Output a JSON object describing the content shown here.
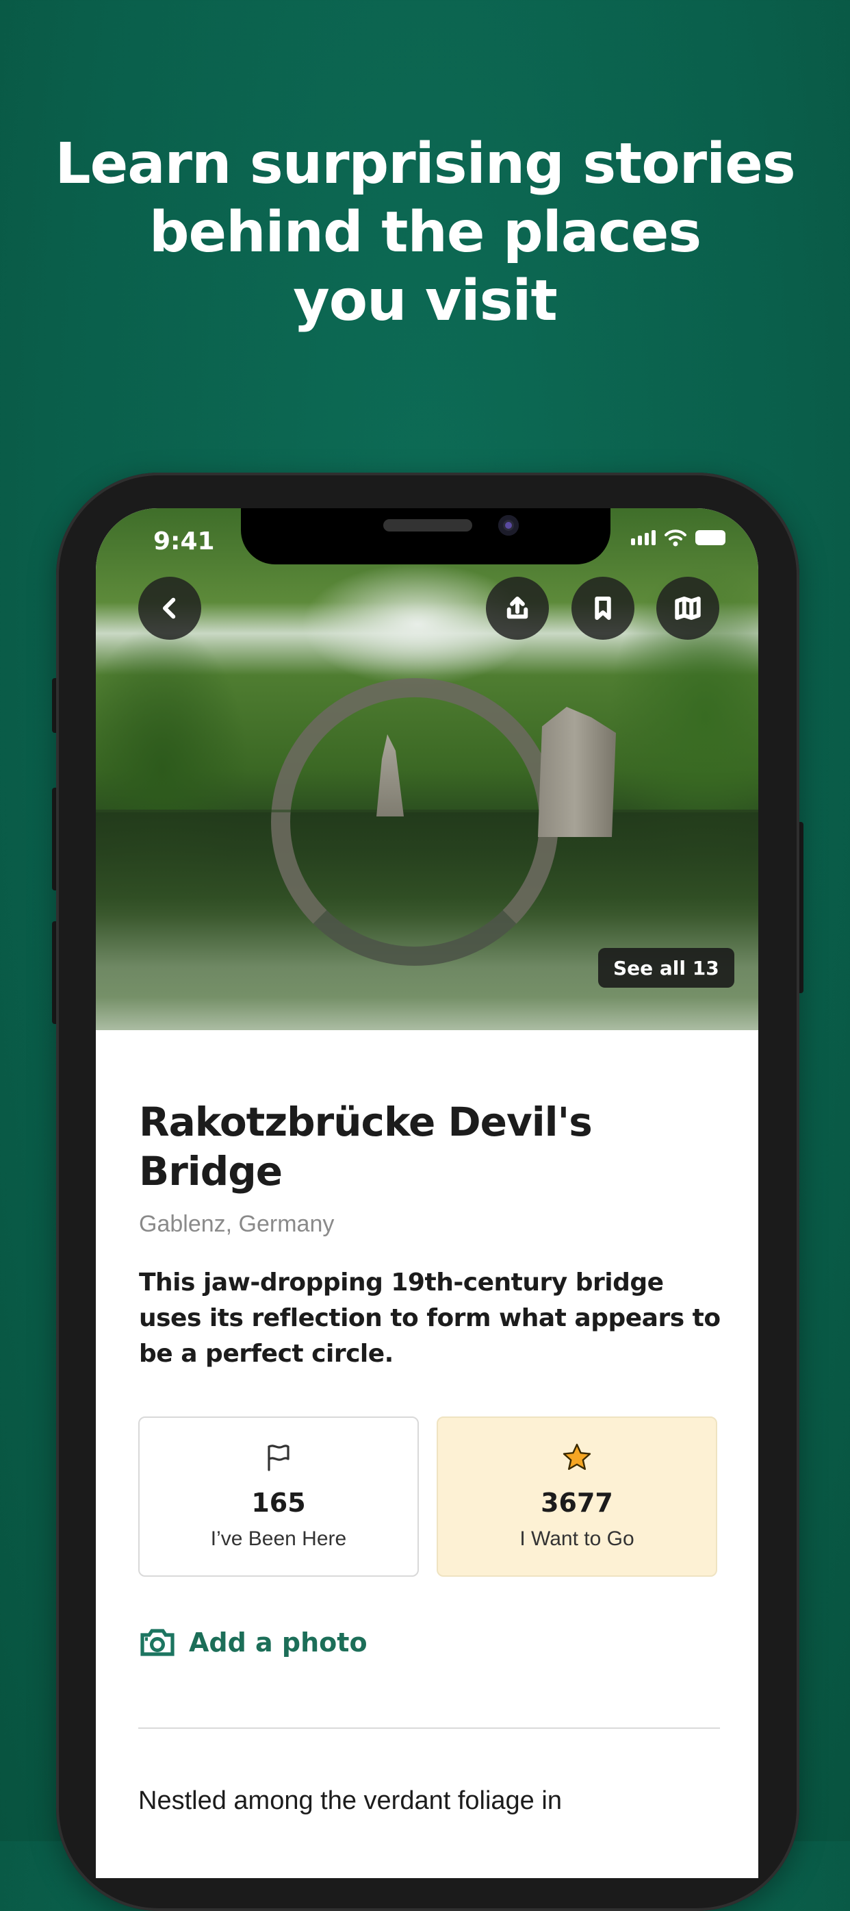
{
  "headline": {
    "line1": "Learn surprising stories",
    "line2": "behind the places",
    "line3": "you visit"
  },
  "status_bar": {
    "time": "9:41"
  },
  "hero": {
    "see_all_label": "See all 13",
    "buttons": [
      "back-icon",
      "share-icon",
      "bookmark-icon",
      "map-icon"
    ]
  },
  "place": {
    "title": "Rakotzbrücke Devil's Bridge",
    "location": "Gablenz, Germany",
    "summary": "This jaw-dropping 19th-century bridge uses its reflection to form what appears to be a perfect circle."
  },
  "stats": {
    "been_here": {
      "count": "165",
      "label": "I’ve Been Here",
      "icon": "flag-icon"
    },
    "want_to_go": {
      "count": "3677",
      "label": "I Want to Go",
      "icon": "star-icon"
    }
  },
  "add_photo_label": "Add a photo",
  "description_start": "Nestled among the verdant foliage in",
  "colors": {
    "background": "#0a5f4b",
    "accent": "#1c6e58",
    "want_card": "#fdf1d4",
    "star": "#f5a623"
  }
}
